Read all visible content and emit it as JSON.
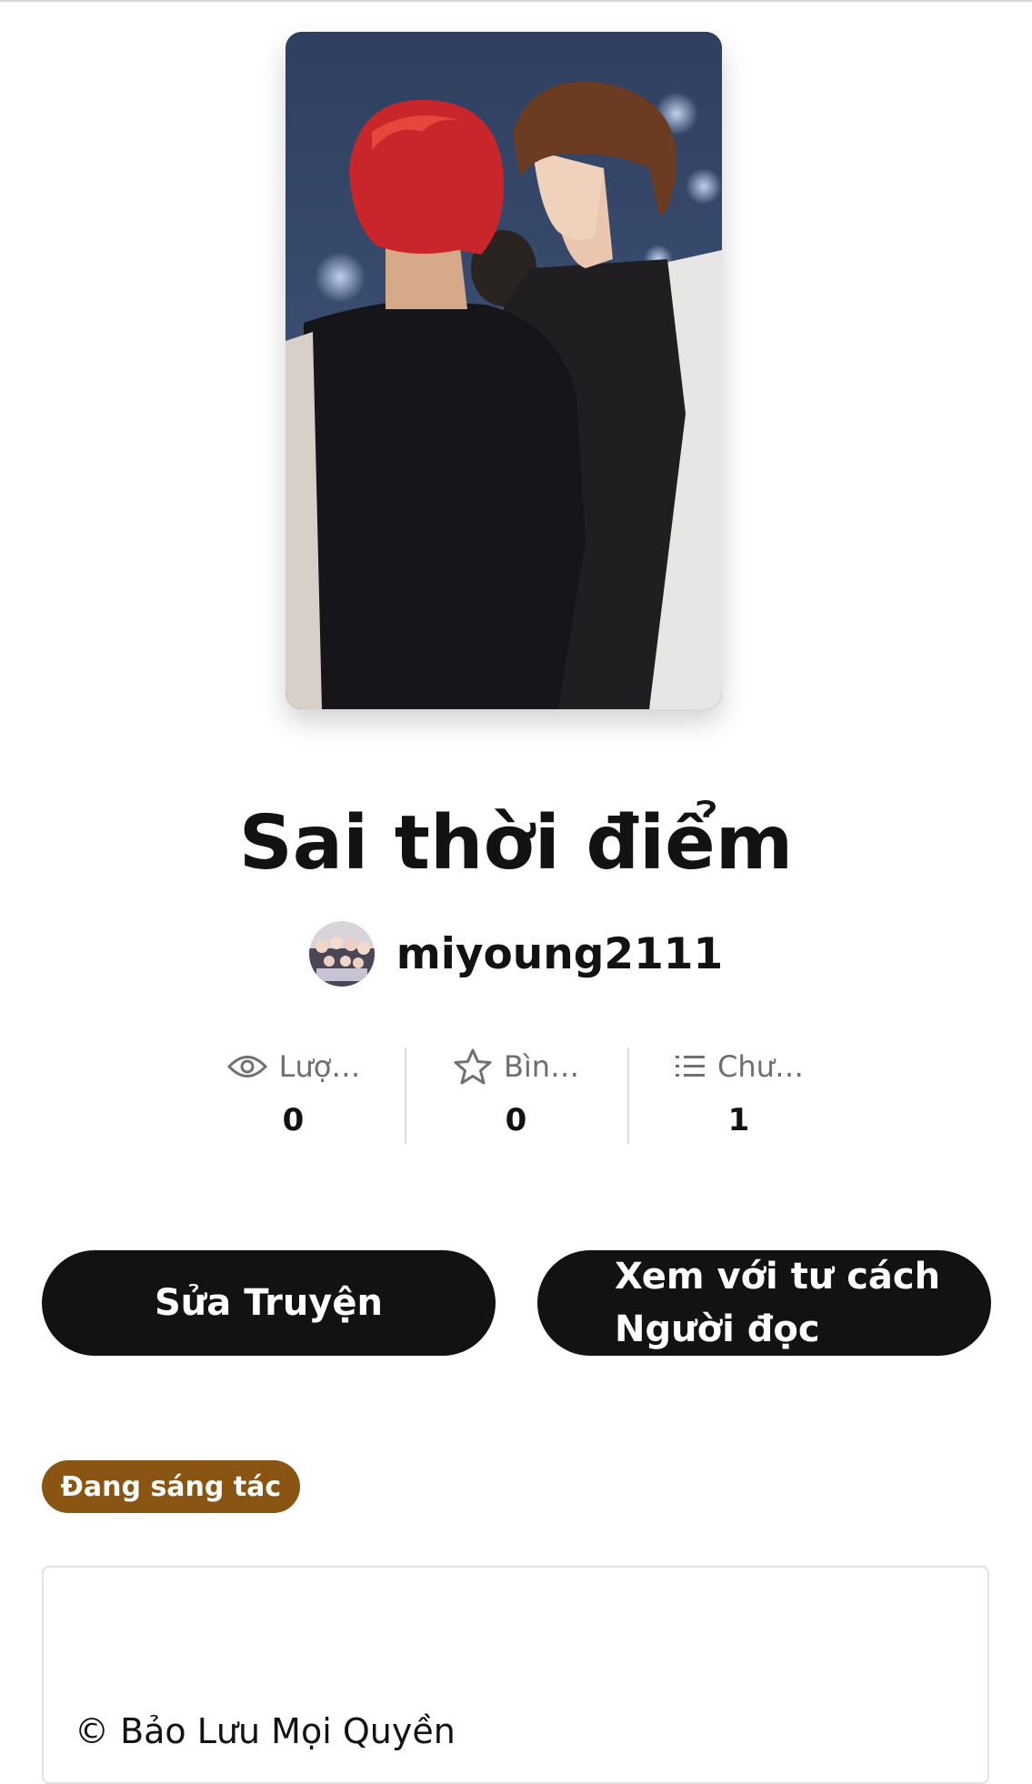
{
  "story": {
    "title": "Sai thời điểm",
    "author": "miyoung2111",
    "status": "Đang sáng tác",
    "copyright": "© Bảo Lưu Mọi Quyền"
  },
  "stats": [
    {
      "label": "Lượ…",
      "value": "0",
      "icon": "eye-icon"
    },
    {
      "label": "Bìn…",
      "value": "0",
      "icon": "star-icon"
    },
    {
      "label": "Chư…",
      "value": "1",
      "icon": "list-icon"
    }
  ],
  "actions": {
    "edit_label": "Sửa Truyện",
    "reader_label_line1": "Xem với tư cách",
    "reader_label_line2": "Người đọc"
  },
  "colors": {
    "button": "#121212",
    "status_badge": "#8a5512"
  }
}
